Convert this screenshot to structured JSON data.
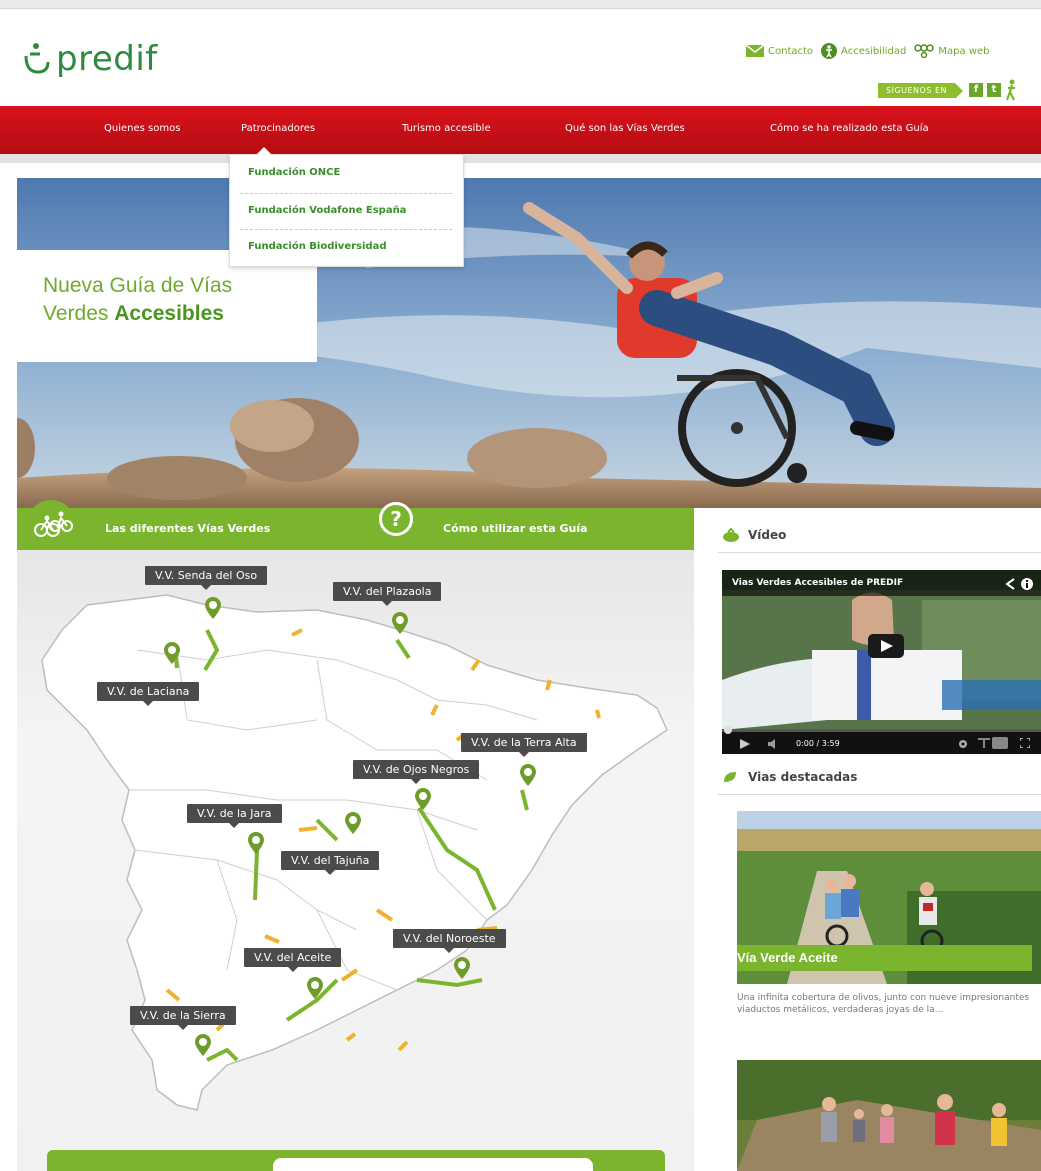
{
  "logo": {
    "text": "predif"
  },
  "utility": {
    "contact": "Contacto",
    "accessibility": "Accesibilidad",
    "sitemap": "Mapa web"
  },
  "social": {
    "follow": "SÍGUENOS EN",
    "facebook": "f",
    "tuenti": "t"
  },
  "nav": {
    "items": [
      {
        "label": "Quienes somos"
      },
      {
        "label": "Patrocinadores"
      },
      {
        "label": "Turismo accesible"
      },
      {
        "label": "Qué son las Vías Verdes"
      },
      {
        "label": "Cómo se ha realizado esta Guía"
      }
    ]
  },
  "dropdown": {
    "items": [
      {
        "label": "Fundación ONCE"
      },
      {
        "label": "Fundación Vodafone España"
      },
      {
        "label": "Fundación Biodiversidad"
      }
    ]
  },
  "hero": {
    "title_line1": "Nueva Guía de Vías",
    "title_line2_prefix": "Verdes ",
    "title_line2_bold": "Accesibles"
  },
  "greenbar": {
    "routes": "Las diferentes Vías Verdes",
    "howto": "Cómo utilizar esta Guía",
    "help_symbol": "?"
  },
  "map": {
    "labels": [
      {
        "text": "V.V. Senda del Oso"
      },
      {
        "text": "V.V. del Plazaola"
      },
      {
        "text": "V.V. de Laciana"
      },
      {
        "text": "V.V. de la Terra Alta"
      },
      {
        "text": "V.V. de Ojos Negros"
      },
      {
        "text": "V.V. de la Jara"
      },
      {
        "text": "V.V. del Tajuña"
      },
      {
        "text": "V.V. del Noroeste"
      },
      {
        "text": "V.V. del Aceite"
      },
      {
        "text": "V.V. de la Sierra"
      }
    ]
  },
  "sidebar": {
    "video_heading": "Vídeo",
    "video_title": "Vias Verdes Accesibles de PREDIF",
    "video_time": "0:00 / 3:59",
    "featured_heading": "Vias destacadas",
    "card1_title": "Vía Verde Aceite",
    "card1_desc": "Una infinita cobertura de olivos, junto con nueve impresionantes viaductos metálicos, verdaderas joyas de la..."
  },
  "colors": {
    "brand_red": "#d9121b",
    "brand_green": "#7ab52d",
    "logo_green": "#2e8a3e"
  }
}
